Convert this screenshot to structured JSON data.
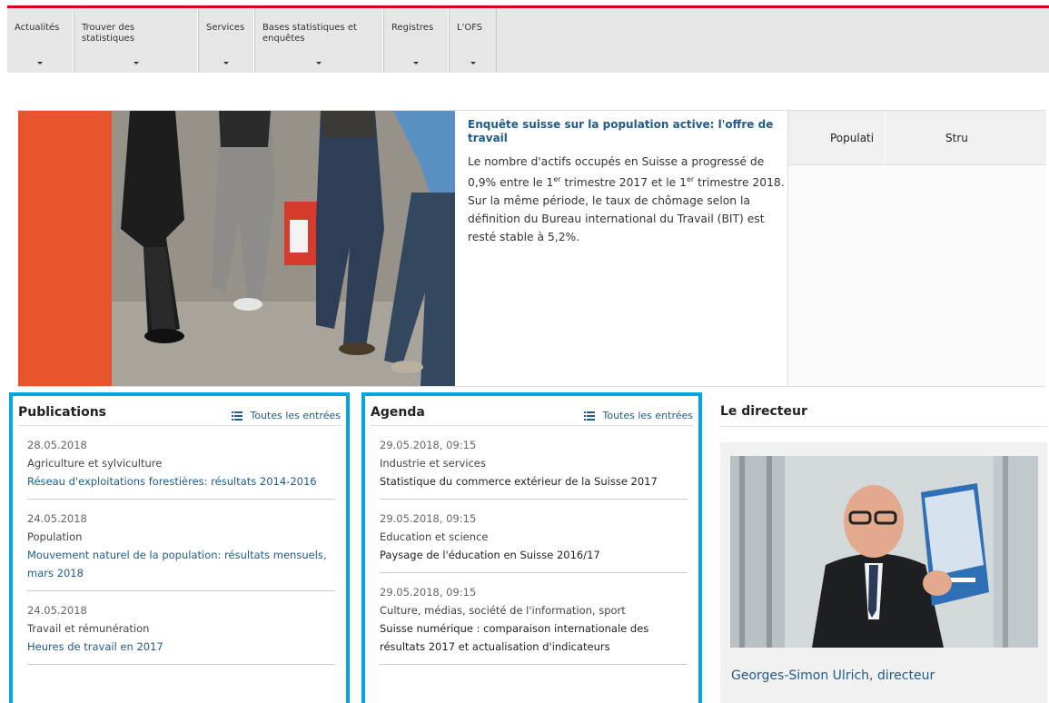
{
  "nav": {
    "items": [
      {
        "label": "Actualités"
      },
      {
        "label": "Trouver des statistiques"
      },
      {
        "label": "Services"
      },
      {
        "label": "Bases statistiques et enquêtes"
      },
      {
        "label": "Registres"
      },
      {
        "label": "L'OFS"
      }
    ]
  },
  "hero": {
    "title": "Enquête suisse sur la population active: l'offre de travail",
    "body_1": "Le nombre d'actifs occupés en Suisse a progressé de 0,9% entre le 1",
    "sup_1": "er",
    "body_2": " trimestre 2017 et le 1",
    "sup_2": "er",
    "body_3": " trimestre 2018. Sur la même période, le taux de chômage selon la définition du Bureau international du Travail (BIT) est resté stable à 5,2%.",
    "tabs": [
      "Populati",
      "Stru"
    ]
  },
  "publications": {
    "title": "Publications",
    "all_link": "Toutes les entrées",
    "entries": [
      {
        "date": "28.05.2018",
        "category": "Agriculture et sylviculture",
        "title": "Réseau d'exploitations forestières: résultats 2014-2016"
      },
      {
        "date": "24.05.2018",
        "category": "Population",
        "title": "Mouvement naturel de la population: résultats mensuels, mars 2018"
      },
      {
        "date": "24.05.2018",
        "category": "Travail et rémunération",
        "title": "Heures de travail en 2017"
      }
    ]
  },
  "agenda": {
    "title": "Agenda",
    "all_link": "Toutes les entrées",
    "entries": [
      {
        "date": "29.05.2018, 09:15",
        "category": "Industrie et services",
        "title": "Statistique du commerce extérieur de la Suisse 2017"
      },
      {
        "date": "29.05.2018, 09:15",
        "category": "Education et science",
        "title": "Paysage de l'éducation en Suisse 2016/17"
      },
      {
        "date": "29.05.2018, 09:15",
        "category": "Culture, médias, société de l'information, sport",
        "title": "Suisse numérique : comparaison internationale des résultats 2017 et actualisation d'indicateurs"
      }
    ]
  },
  "director": {
    "title": "Le directeur",
    "name": "Georges-Simon Ulrich, directeur"
  },
  "colors": {
    "accent_red": "#dc0018",
    "hero_orange": "#e8542b",
    "link_blue": "#1f5b8c",
    "highlight_border": "#00a6e2"
  }
}
